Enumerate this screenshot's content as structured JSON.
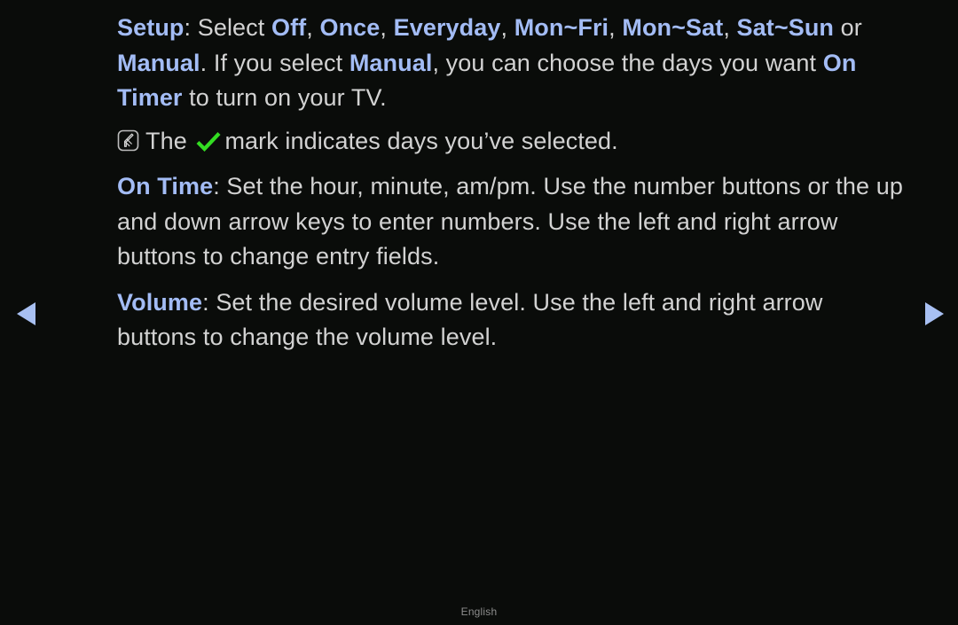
{
  "screen": {
    "background_color": "#0a0c0a",
    "body_text_color": "#d2d2d2",
    "accent_color": "#a3bcf5",
    "check_color": "#33dd22",
    "arrow_color": "#a8c0f2"
  },
  "paragraphs": {
    "setup": {
      "term": "Setup",
      "after_term": ": Select ",
      "options": [
        "Off",
        "Once",
        "Everyday",
        "Mon~Fri",
        "Mon~Sat",
        "Sat~Sun"
      ],
      "sep": ", ",
      "or_word": " or ",
      "last_option": "Manual",
      "end_punct": ".",
      "second_sentence_a": "If you select ",
      "second_sentence_term": "Manual",
      "second_sentence_b": ", you can choose the days you want ",
      "second_sentence_term2": "On Timer",
      "second_sentence_c": " to turn on your TV."
    },
    "note": {
      "icon": "note-icon",
      "before_check": "The ",
      "check_icon": "check-icon",
      "after_check": "mark indicates days you’ve selected."
    },
    "on_time": {
      "term": "On Time",
      "text": ": Set the hour, minute, am/pm. Use the number buttons or the up and down arrow keys to enter numbers. Use the left and right arrow buttons to change entry fields."
    },
    "volume": {
      "term": "Volume",
      "text": ": Set the desired volume level. Use the left and right arrow buttons to change the volume level."
    }
  },
  "nav": {
    "prev_label": "previous-page-arrow",
    "next_label": "next-page-arrow"
  },
  "footer": {
    "language": "English"
  }
}
